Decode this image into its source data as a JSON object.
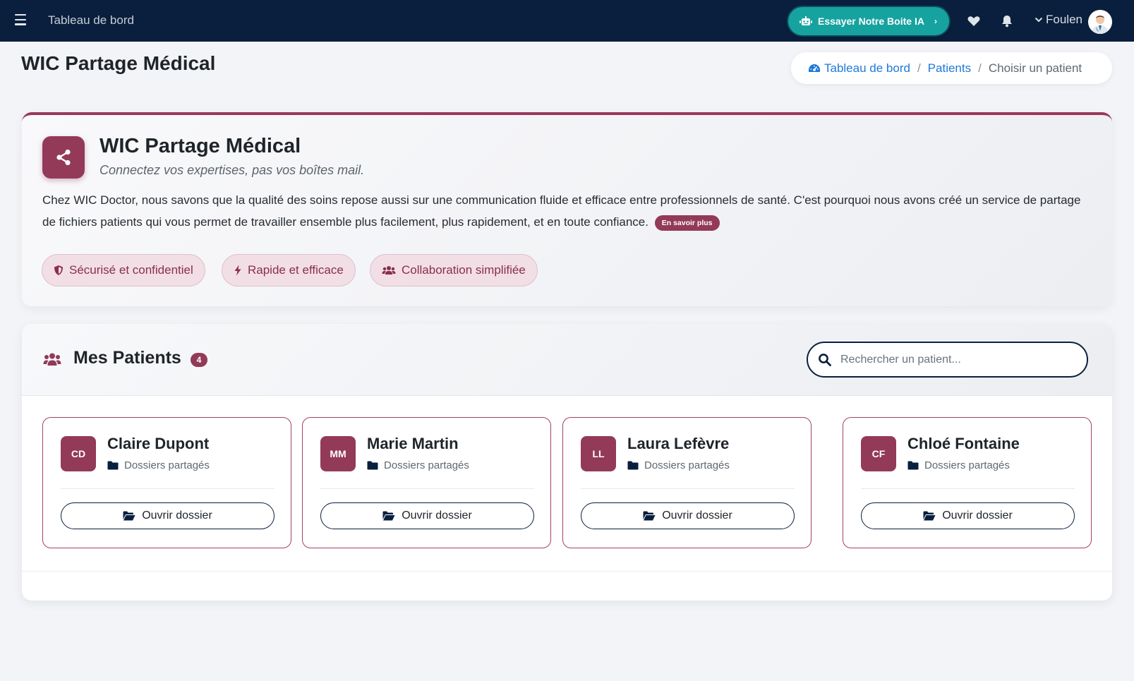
{
  "navbar": {
    "title": "Tableau de bord",
    "ai_button": "Essayer Notre Boite IA",
    "user_name": "Foulen"
  },
  "page": {
    "title": "WIC Partage Médical"
  },
  "breadcrumb": {
    "items": [
      "Tableau de bord",
      "Patients"
    ],
    "current": "Choisir un patient"
  },
  "intro": {
    "title": "WIC Partage Médical",
    "subtitle": "Connectez vos expertises, pas vos boîtes mail.",
    "text": "Chez WIC Doctor, nous savons que la qualité des soins repose aussi sur une communication fluide et efficace entre professionnels de santé. C'est pourquoi nous avons créé un service de partage de fichiers patients qui vous permet de travailler ensemble plus facilement, plus rapidement, et en toute confiance.",
    "learn_more": "En savoir plus",
    "features": [
      "Sécurisé et confidentiel",
      "Rapide et efficace",
      "Collaboration simplifiée"
    ]
  },
  "patients": {
    "title": "Mes Patients",
    "count": "4",
    "search_placeholder": "Rechercher un patient...",
    "items": [
      {
        "initials": "CD",
        "name": "Claire Dupont",
        "subtitle": "Dossiers partagés",
        "button": "Ouvrir dossier"
      },
      {
        "initials": "MM",
        "name": "Marie Martin",
        "subtitle": "Dossiers partagés",
        "button": "Ouvrir dossier"
      },
      {
        "initials": "LL",
        "name": "Laura Lefèvre",
        "subtitle": "Dossiers partagés",
        "button": "Ouvrir dossier"
      },
      {
        "initials": "CF",
        "name": "Chloé Fontaine",
        "subtitle": "Dossiers partagés",
        "button": "Ouvrir dossier"
      }
    ]
  },
  "colors": {
    "navbar": "#0a1f3d",
    "accent": "#933a58",
    "ai_button": "#16a3a0",
    "link": "#1e7ad6"
  },
  "icons": {
    "menu": "hamburger-icon",
    "ai": "robot-icon",
    "favorites": "heart-icon",
    "notifications": "bell-icon",
    "share": "share-icon",
    "search": "search-icon",
    "folder": "folder-icon",
    "folder_open": "folder-open-icon"
  }
}
